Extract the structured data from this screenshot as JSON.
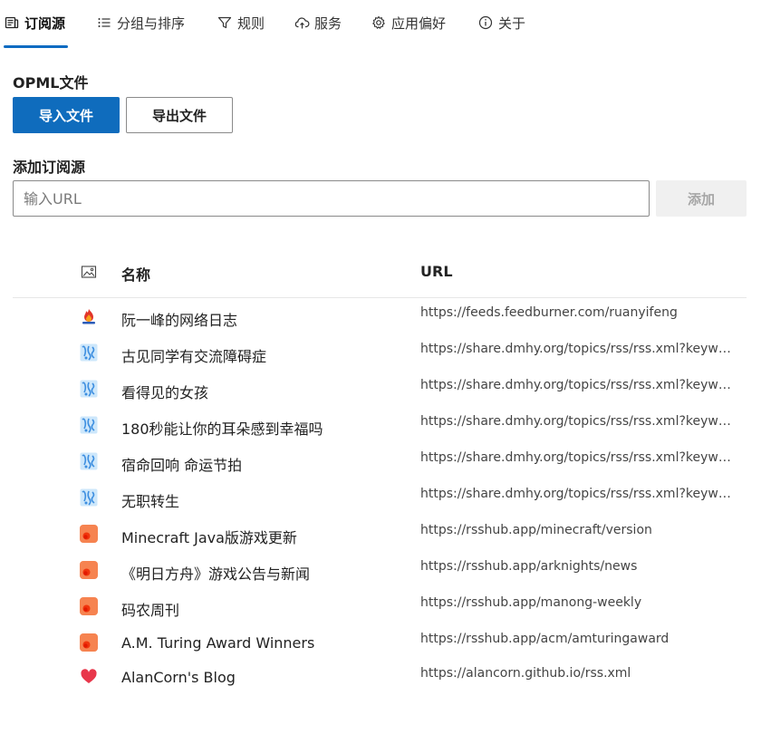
{
  "tabs": [
    {
      "label": "订阅源",
      "icon": "feed-icon",
      "active": true
    },
    {
      "label": "分组与排序",
      "icon": "list-icon",
      "active": false
    },
    {
      "label": "规则",
      "icon": "filter-icon",
      "active": false
    },
    {
      "label": "服务",
      "icon": "cloud-sync-icon",
      "active": false
    },
    {
      "label": "应用偏好",
      "icon": "gear-icon",
      "active": false
    },
    {
      "label": "关于",
      "icon": "info-icon",
      "active": false
    }
  ],
  "opml": {
    "title": "OPML文件",
    "import_label": "导入文件",
    "export_label": "导出文件"
  },
  "add": {
    "title": "添加订阅源",
    "placeholder": "输入URL",
    "button_label": "添加"
  },
  "table": {
    "icon_column": "image-icon",
    "name_header": "名称",
    "url_header": "URL",
    "rows": [
      {
        "icon": "ruanyifeng-icon",
        "name": "阮一峰的网络日志",
        "url": "https://feeds.feedburner.com/ruanyifeng"
      },
      {
        "icon": "dmhy-icon",
        "name": "古见同学有交流障碍症",
        "url": "https://share.dmhy.org/topics/rss/rss.xml?keyword=..."
      },
      {
        "icon": "dmhy-icon",
        "name": "看得见的女孩",
        "url": "https://share.dmhy.org/topics/rss/rss.xml?keyword=..."
      },
      {
        "icon": "dmhy-icon",
        "name": "180秒能让你的耳朵感到幸福吗",
        "url": "https://share.dmhy.org/topics/rss/rss.xml?keyword=..."
      },
      {
        "icon": "dmhy-icon",
        "name": "宿命回响 命运节拍",
        "url": "https://share.dmhy.org/topics/rss/rss.xml?keyword=..."
      },
      {
        "icon": "dmhy-icon",
        "name": "无职转生",
        "url": "https://share.dmhy.org/topics/rss/rss.xml?keyword=..."
      },
      {
        "icon": "rsshub-icon",
        "name": "Minecraft Java版游戏更新",
        "url": "https://rsshub.app/minecraft/version"
      },
      {
        "icon": "rsshub-icon",
        "name": "《明日方舟》游戏公告与新闻",
        "url": "https://rsshub.app/arknights/news"
      },
      {
        "icon": "rsshub-icon",
        "name": "码农周刊",
        "url": "https://rsshub.app/manong-weekly"
      },
      {
        "icon": "rsshub-icon",
        "name": "A.M. Turing Award Winners",
        "url": "https://rsshub.app/acm/amturingaward"
      },
      {
        "icon": "heart-icon",
        "name": "AlanCorn's Blog",
        "url": "https://alancorn.github.io/rss.xml"
      }
    ]
  },
  "colors": {
    "accent": "#0f6cbd",
    "rsshub": "#f5672f",
    "dmhy": "#5aa6e6",
    "heart": "#e8374b"
  }
}
